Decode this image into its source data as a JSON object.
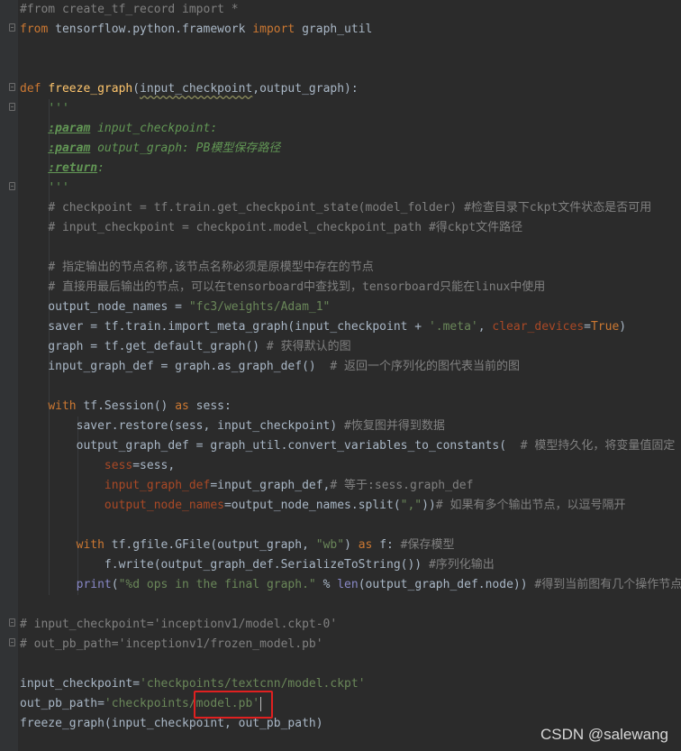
{
  "colors": {
    "background": "#2b2b2b",
    "gutter": "#313335",
    "default_text": "#a9b7c6",
    "comment": "#808080",
    "keyword": "#cc7832",
    "function": "#ffc66d",
    "string": "#6a8759",
    "docstring": "#629755",
    "parameter": "#aa4926",
    "builtin": "#8888c6",
    "highlight_box": "#e02020"
  },
  "code_lines": [
    {
      "name": "line-import-comment",
      "segments": [
        [
          "cm",
          "#from create_tf_record import *"
        ]
      ]
    },
    {
      "name": "line-import-graph-util",
      "segments": [
        [
          "kw",
          "from"
        ],
        [
          "",
          " tensorflow.python.framework "
        ],
        [
          "kw",
          "import"
        ],
        [
          "",
          " graph_util"
        ]
      ]
    },
    {
      "name": "line-blank",
      "segments": []
    },
    {
      "name": "line-blank",
      "segments": []
    },
    {
      "name": "line-def-freeze-graph",
      "segments": [
        [
          "kw",
          "def"
        ],
        [
          "",
          " "
        ],
        [
          "fn",
          "freeze_graph"
        ],
        [
          "",
          "("
        ],
        [
          "sq",
          "input_checkpoint"
        ],
        [
          "",
          ","
        ],
        [
          "",
          "output_graph):"
        ]
      ]
    },
    {
      "name": "line-docstring-open",
      "segments": [
        [
          "",
          "    "
        ],
        [
          "ds",
          "'''"
        ]
      ]
    },
    {
      "name": "line-docstring-param-input",
      "segments": [
        [
          "",
          "    "
        ],
        [
          "dt",
          ":param"
        ],
        [
          "ds",
          " input_checkpoint:"
        ]
      ]
    },
    {
      "name": "line-docstring-param-output",
      "segments": [
        [
          "",
          "    "
        ],
        [
          "dt",
          ":param"
        ],
        [
          "ds",
          " output_graph: PB模型保存路径"
        ]
      ]
    },
    {
      "name": "line-docstring-return",
      "segments": [
        [
          "",
          "    "
        ],
        [
          "dt",
          ":return"
        ],
        [
          "ds",
          ":"
        ]
      ]
    },
    {
      "name": "line-docstring-close",
      "segments": [
        [
          "",
          "    "
        ],
        [
          "ds",
          "'''"
        ]
      ]
    },
    {
      "name": "line-comment-checkpoint",
      "segments": [
        [
          "",
          "    "
        ],
        [
          "cm",
          "# checkpoint = tf.train.get_checkpoint_state(model_folder) #检查目录下ckpt文件状态是否可用"
        ]
      ]
    },
    {
      "name": "line-comment-input-checkpoint",
      "segments": [
        [
          "",
          "    "
        ],
        [
          "cm",
          "# input_checkpoint = checkpoint.model_checkpoint_path #得ckpt文件路径"
        ]
      ]
    },
    {
      "name": "line-blank",
      "segments": []
    },
    {
      "name": "line-comment-output-nodes",
      "segments": [
        [
          "",
          "    "
        ],
        [
          "cm",
          "# 指定输出的节点名称,该节点名称必须是原模型中存在的节点"
        ]
      ]
    },
    {
      "name": "line-comment-tensorboard",
      "segments": [
        [
          "",
          "    "
        ],
        [
          "cm",
          "# 直接用最后输出的节点，可以在tensorboard中查找到，tensorboard只能在linux中使用"
        ]
      ]
    },
    {
      "name": "line-output-node-names",
      "segments": [
        [
          "",
          "    output_node_names = "
        ],
        [
          "st",
          "\"fc3/weights/Adam_1\""
        ]
      ]
    },
    {
      "name": "line-saver",
      "segments": [
        [
          "",
          "    saver = tf.train.import_meta_graph(input_checkpoint + "
        ],
        [
          "st",
          "'.meta'"
        ],
        [
          "",
          ", "
        ],
        [
          "pm",
          "clear_devices"
        ],
        [
          "",
          "="
        ],
        [
          "kw",
          "True"
        ],
        [
          "",
          ")"
        ]
      ]
    },
    {
      "name": "line-graph",
      "segments": [
        [
          "",
          "    graph = tf.get_default_graph()"
        ],
        [
          "cm",
          " # 获得默认的图"
        ]
      ]
    },
    {
      "name": "line-input-graph-def",
      "segments": [
        [
          "",
          "    input_graph_def = graph.as_graph_def()  "
        ],
        [
          "cm",
          "# 返回一个序列化的图代表当前的图"
        ]
      ]
    },
    {
      "name": "line-blank",
      "segments": []
    },
    {
      "name": "line-with-session",
      "segments": [
        [
          "",
          "    "
        ],
        [
          "kw",
          "with"
        ],
        [
          "",
          " tf.Session() "
        ],
        [
          "kw",
          "as"
        ],
        [
          "",
          " sess:"
        ]
      ]
    },
    {
      "name": "line-saver-restore",
      "segments": [
        [
          "",
          "        saver.restore(sess, input_checkpoint)"
        ],
        [
          "cm",
          " #恢复图并得到数据"
        ]
      ]
    },
    {
      "name": "line-output-graph-def",
      "segments": [
        [
          "",
          "        output_graph_def = graph_util.convert_variables_to_constants(  "
        ],
        [
          "cm",
          "# 模型持久化，将变量值固定"
        ]
      ]
    },
    {
      "name": "line-arg-sess",
      "segments": [
        [
          "",
          "            "
        ],
        [
          "pm",
          "sess"
        ],
        [
          "",
          "=sess,"
        ]
      ]
    },
    {
      "name": "line-arg-input-graph-def",
      "segments": [
        [
          "",
          "            "
        ],
        [
          "pm",
          "input_graph_def"
        ],
        [
          "",
          "=input_graph_def,"
        ],
        [
          "cm",
          "# 等于:sess.graph_def"
        ]
      ]
    },
    {
      "name": "line-arg-output-node-names",
      "segments": [
        [
          "",
          "            "
        ],
        [
          "pm",
          "output_node_names"
        ],
        [
          "",
          "=output_node_names.split("
        ],
        [
          "st",
          "\",\""
        ],
        [
          "",
          "))"
        ],
        [
          "cm",
          "# 如果有多个输出节点，以逗号隔开"
        ]
      ]
    },
    {
      "name": "line-blank",
      "segments": []
    },
    {
      "name": "line-with-gfile",
      "segments": [
        [
          "",
          "        "
        ],
        [
          "kw",
          "with"
        ],
        [
          "",
          " tf.gfile.GFile(output_graph, "
        ],
        [
          "st",
          "\"wb\""
        ],
        [
          "",
          ") "
        ],
        [
          "kw",
          "as"
        ],
        [
          "",
          " f:"
        ],
        [
          "cm",
          " #保存模型"
        ]
      ]
    },
    {
      "name": "line-f-write",
      "segments": [
        [
          "",
          "            f.write(output_graph_def.SerializeToString())"
        ],
        [
          "cm",
          " #序列化输出"
        ]
      ]
    },
    {
      "name": "line-print",
      "segments": [
        [
          "",
          "        "
        ],
        [
          "bi",
          "print"
        ],
        [
          "",
          "("
        ],
        [
          "st",
          "\"%d ops in the final graph.\""
        ],
        [
          "",
          " % "
        ],
        [
          "bi",
          "len"
        ],
        [
          "",
          "(output_graph_def.node))"
        ],
        [
          "cm",
          " #得到当前图有几个操作节点"
        ]
      ]
    },
    {
      "name": "line-blank",
      "segments": []
    },
    {
      "name": "line-comment-input-ckpt-0",
      "segments": [
        [
          "cm",
          "# input_checkpoint='inceptionv1/model.ckpt-0'"
        ]
      ]
    },
    {
      "name": "line-comment-out-pb-path",
      "segments": [
        [
          "cm",
          "# out_pb_path='inceptionv1/frozen_model.pb'"
        ]
      ]
    },
    {
      "name": "line-blank",
      "segments": []
    },
    {
      "name": "line-input-checkpoint-assign",
      "segments": [
        [
          "",
          "input_checkpoint="
        ],
        [
          "st",
          "'checkpoints/textcnn/model.ckpt'"
        ]
      ]
    },
    {
      "name": "line-out-pb-path-assign",
      "segments": [
        [
          "",
          "out_pb_path="
        ],
        [
          "st",
          "'checkpoints/model.pb'"
        ]
      ],
      "caret": true
    },
    {
      "name": "line-call-freeze-graph",
      "segments": [
        [
          "",
          "freeze_graph(input_checkpoint, out_pb_path)"
        ]
      ]
    }
  ],
  "watermark": "CSDN @salewang"
}
